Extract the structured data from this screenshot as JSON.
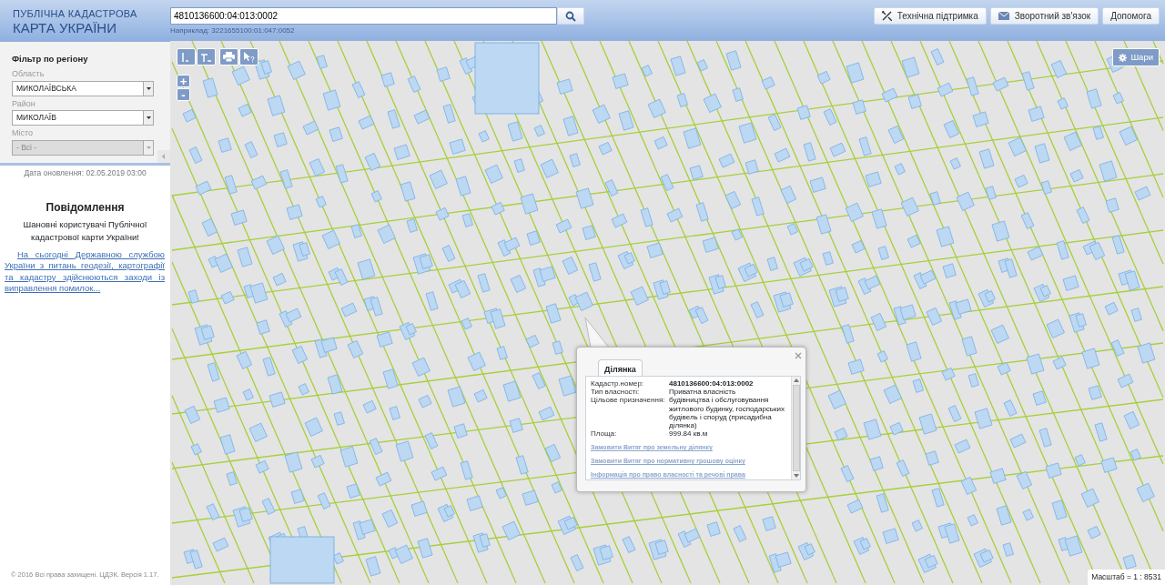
{
  "header": {
    "title_line1": "ПУБЛІЧНА КАДАСТРОВА",
    "title_line2": "КАРТА УКРАЇНИ",
    "search": {
      "value": "4810136600:04:013:0002",
      "hint": "Наприклад: 3221655100:01:047:0052"
    },
    "buttons": [
      {
        "label": "Технічна підтримка",
        "kind": "tools"
      },
      {
        "label": "Зворотний зв'язок",
        "kind": "mail"
      },
      {
        "label": "Допомога",
        "kind": "plain"
      }
    ]
  },
  "sidebar": {
    "filter_title": "Фільтр по регіону",
    "fields": [
      {
        "label": "Область",
        "value": "МИКОЛАЇВСЬКА",
        "disabled": false
      },
      {
        "label": "Район",
        "value": "МИКОЛАЇВ",
        "disabled": false
      },
      {
        "label": "Місто",
        "value": "- Всі -",
        "disabled": true
      }
    ],
    "update_date": "Дата оновлення: 02.05.2019 03:00",
    "notice": {
      "title": "Повідомлення",
      "greeting": "Шановні користувачі Публічної кадастрової карти України!",
      "link": "На сьогодні Державною службою України з питань геодезії, картографії та кадастру здійснюються заходи із виправлення помилок..."
    },
    "footer": "© 2016 Всі права захищені. ЦДЗК. Версія 1.17."
  },
  "map": {
    "zoom_buttons": [
      "+",
      "-"
    ],
    "layers_button": "Шари",
    "popup": {
      "tab": "Ділянка",
      "rows": [
        {
          "label": "Кадастр.номер:",
          "value": "4810136600:04:013:0002",
          "bold": true
        },
        {
          "label": "Тип власності:",
          "value": "Приватна власність",
          "bold": false
        },
        {
          "label": "Цільове призначення:",
          "value": "будівництва і обслуговування житлового будинку, господарських будівель і споруд (присадибна ділянка)",
          "bold": false
        },
        {
          "label": "Площа:",
          "value": "999.84 кв.м",
          "bold": false
        }
      ],
      "links": [
        "Замовити Витяг про земельну ділянку",
        "Замовити Витяг про нормативну грошову оцінку",
        "Інформація про право власності та речові права"
      ]
    },
    "scale": "Масштаб = 1 : 8531"
  }
}
